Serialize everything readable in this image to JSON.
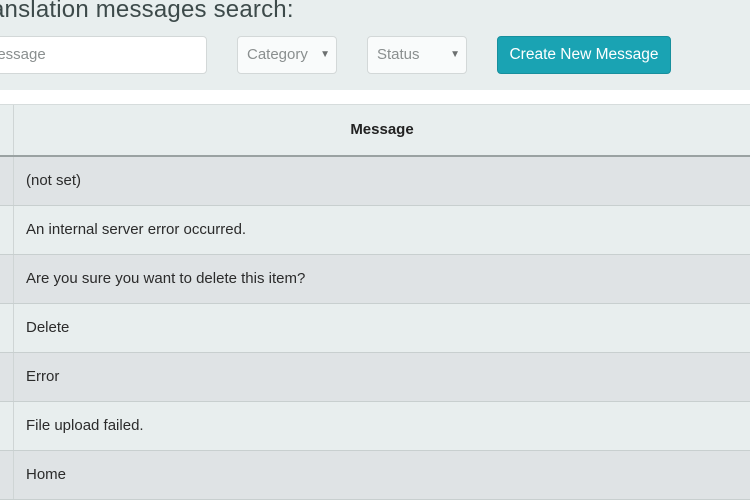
{
  "page": {
    "heading": "anslation messages search:"
  },
  "search": {
    "message_placeholder": "Message",
    "message_visible_text": "lessage",
    "category_label": "Category",
    "status_label": "Status",
    "create_button": "Create New Message"
  },
  "table": {
    "header": "Message",
    "rows": [
      "(not set)",
      "An internal server error occurred.",
      "Are you sure you want to delete this item?",
      "Delete",
      "Error",
      "File upload failed.",
      "Home"
    ]
  },
  "colors": {
    "accent": "#1aa3b3",
    "background": "#e8eeee",
    "row_striped": "#dfe3e5"
  }
}
